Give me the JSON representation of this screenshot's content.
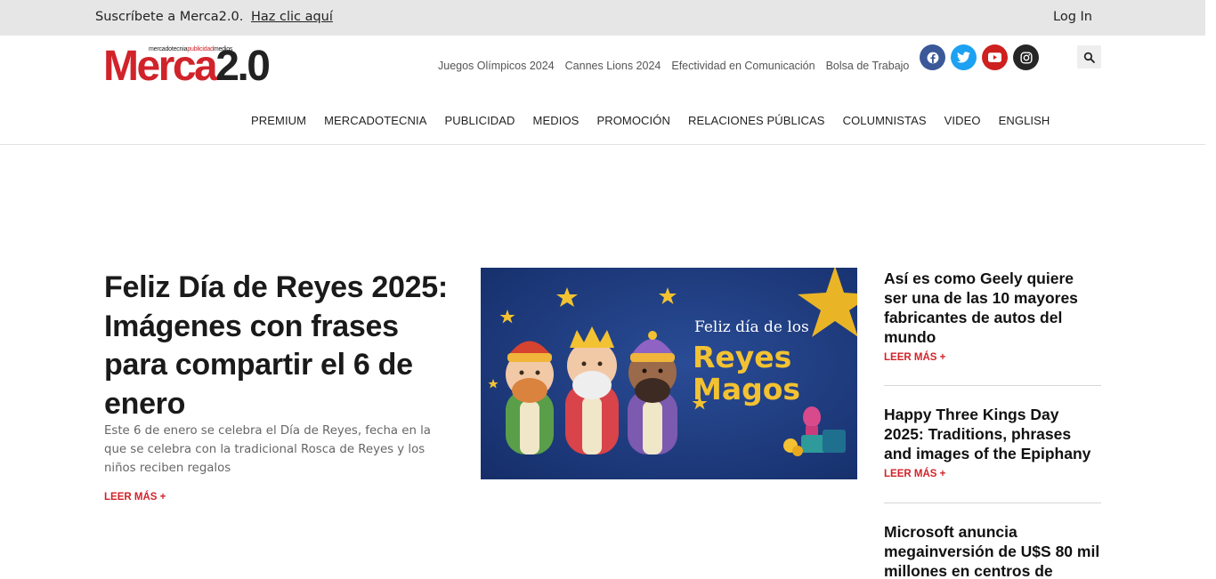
{
  "topbar": {
    "subscribe_text": "Suscríbete a Merca2.0.",
    "subscribe_link": "Haz clic aquí",
    "login": "Log In"
  },
  "logo": {
    "tagline_a": "mercadotecnia",
    "tagline_b": "publicidad",
    "tagline_c": "medios",
    "word_a": "Merca",
    "word_b": "2.0"
  },
  "toplinks": [
    "Juegos Olímpicos 2024",
    "Cannes Lions 2024",
    "Efectividad en Comunicación",
    "Bolsa de Trabajo"
  ],
  "social": {
    "facebook_color": "#3b5998",
    "twitter_color": "#1da1f2",
    "youtube_color": "#cd201f",
    "instagram_color": "#262626"
  },
  "nav": [
    "PREMIUM",
    "MERCADOTECNIA",
    "PUBLICIDAD",
    "MEDIOS",
    "PROMOCIÓN",
    "RELACIONES PÚBLICAS",
    "COLUMNISTAS",
    "VIDEO",
    "ENGLISH"
  ],
  "hero": {
    "title": "Feliz Día de Reyes 2025: Imágenes con frases para compartir el 6 de enero",
    "excerpt": "Este 6 de enero se celebra el Día de Reyes, fecha en la que se celebra con la tradicional Rosca de Reyes y los niños reciben regalos",
    "more": "LEER MÁS +",
    "image_line1": "Feliz día de los",
    "image_line2": "Reyes",
    "image_line3": "Magos"
  },
  "sidebar": [
    {
      "title": "Así es como Geely quiere ser una de las 10 mayores fabricantes de autos del mundo",
      "more": "LEER MÁS +"
    },
    {
      "title": "Happy Three Kings Day 2025: Traditions, phrases and images of the Epiphany",
      "more": "LEER MÁS +"
    },
    {
      "title": "Microsoft anuncia megainversión de U$S 80 mil millones en centros de"
    }
  ]
}
